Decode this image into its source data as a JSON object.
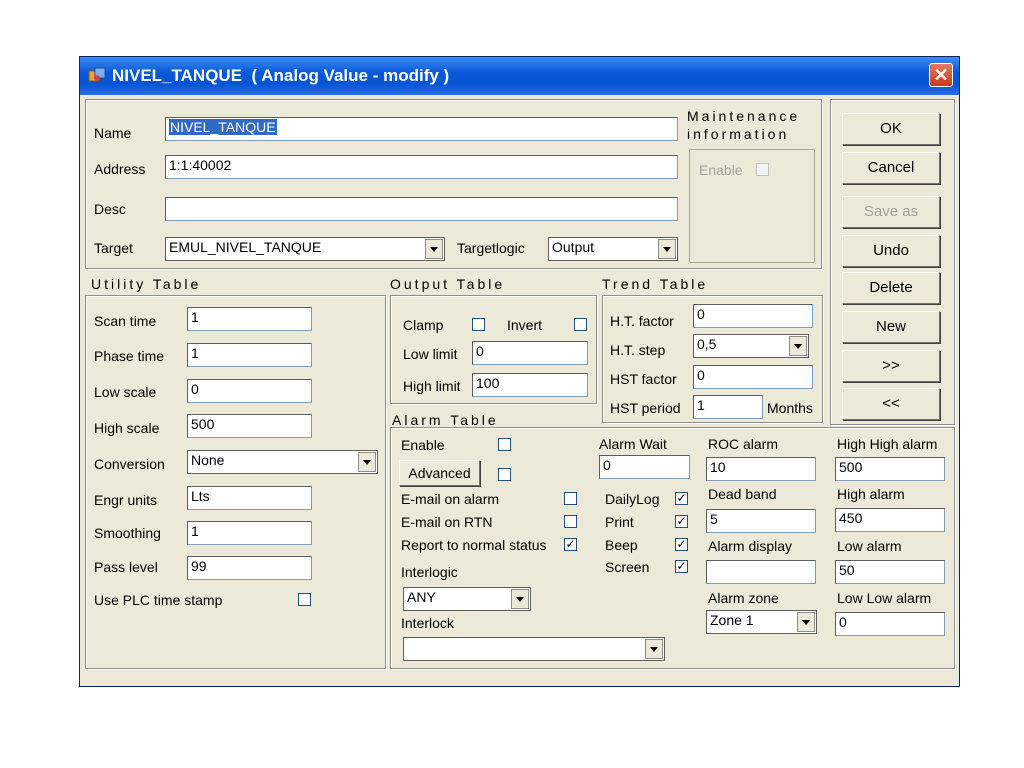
{
  "window": {
    "title": "NIVEL_TANQUE  ( Analog Value - modify )"
  },
  "header": {
    "name_label": "Name",
    "name_value": "NIVEL_TANQUE",
    "address_label": "Address",
    "address_value": "1:1:40002",
    "desc_label": "Desc",
    "desc_value": "",
    "target_label": "Target",
    "target_value": "EMUL_NIVEL_TANQUE",
    "targetlogic_label": "Targetlogic",
    "targetlogic_value": "Output"
  },
  "maintenance": {
    "title_line1": "Maintenance",
    "title_line2": "information",
    "enable_label": "Enable"
  },
  "buttons": {
    "ok": "OK",
    "cancel": "Cancel",
    "save_as": "Save as",
    "undo": "Undo",
    "delete": "Delete",
    "new": "New",
    "next": ">>",
    "prev": "<<"
  },
  "utility": {
    "title": "Utility Table",
    "scan_time_label": "Scan time",
    "scan_time": "1",
    "phase_time_label": "Phase time",
    "phase_time": "1",
    "low_scale_label": "Low scale",
    "low_scale": "0",
    "high_scale_label": "High scale",
    "high_scale": "500",
    "conversion_label": "Conversion",
    "conversion": "None",
    "engr_units_label": "Engr units",
    "engr_units": "Lts",
    "smoothing_label": "Smoothing",
    "smoothing": "1",
    "pass_level_label": "Pass level",
    "pass_level": "99",
    "plc_stamp_label": "Use PLC time stamp"
  },
  "output": {
    "title": "Output Table",
    "clamp_label": "Clamp",
    "invert_label": "Invert",
    "low_limit_label": "Low limit",
    "low_limit": "0",
    "high_limit_label": "High limit",
    "high_limit": "100"
  },
  "trend": {
    "title": "Trend Table",
    "ht_factor_label": "H.T. factor",
    "ht_factor": "0",
    "ht_step_label": "H.T. step",
    "ht_step": "0,5",
    "hst_factor_label": "HST factor",
    "hst_factor": "0",
    "hst_period_label": "HST period",
    "hst_period": "1",
    "months_label": "Months"
  },
  "alarm": {
    "title": "Alarm Table",
    "enable_label": "Enable",
    "advanced_label": "Advanced",
    "email_alarm_label": "E-mail on alarm",
    "email_rtn_label": "E-mail on RTN",
    "report_normal_label": "Report to normal status",
    "check_mark": "✓",
    "interlogic_label": "Interlogic",
    "interlogic": "ANY",
    "interlock_label": "Interlock",
    "interlock": "",
    "alarm_wait_label": "Alarm Wait",
    "alarm_wait": "0",
    "dailylog_label": "DailyLog",
    "print_label": "Print",
    "beep_label": "Beep",
    "screen_label": "Screen",
    "roc_label": "ROC alarm",
    "roc": "10",
    "dead_band_label": "Dead band",
    "dead_band": "5",
    "alarm_display_label": "Alarm display",
    "alarm_display": "",
    "alarm_zone_label": "Alarm zone",
    "alarm_zone": "Zone 1",
    "high_high_label": "High High alarm",
    "high_high": "500",
    "high_label": "High alarm",
    "high": "450",
    "low_label": "Low alarm",
    "low": "50",
    "low_low_label": "Low Low alarm",
    "low_low": "0"
  }
}
